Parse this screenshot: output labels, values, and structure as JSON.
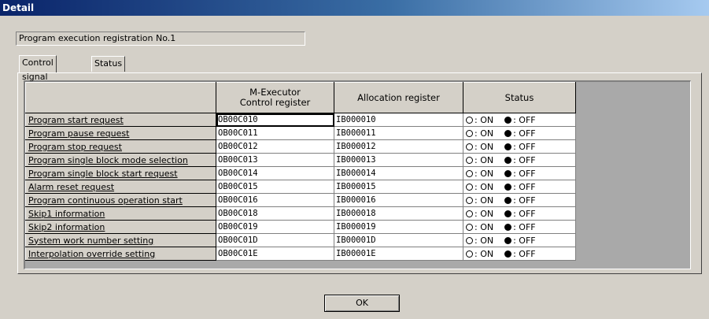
{
  "window": {
    "title": "Detail"
  },
  "group_label": "Program execution registration No.1",
  "tabs": [
    {
      "label": "Control signal"
    },
    {
      "label": "Status"
    }
  ],
  "table": {
    "headers": {
      "mexec_line1": "M-Executor",
      "mexec_line2": "Control register",
      "alloc": "Allocation register",
      "status": "Status"
    },
    "status_on": ": ON",
    "status_off": ": OFF",
    "rows": [
      {
        "name": "Program start request",
        "mexec": "OB00C010",
        "alloc": "IB000010"
      },
      {
        "name": "Program pause request",
        "mexec": "OB00C011",
        "alloc": "IB000011"
      },
      {
        "name": "Program stop request",
        "mexec": "OB00C012",
        "alloc": "IB000012"
      },
      {
        "name": "Program single block mode selection",
        "mexec": "OB00C013",
        "alloc": "IB000013"
      },
      {
        "name": "Program single block start request",
        "mexec": "OB00C014",
        "alloc": "IB000014"
      },
      {
        "name": "Alarm reset request",
        "mexec": "OB00C015",
        "alloc": "IB000015"
      },
      {
        "name": "Program continuous operation start",
        "mexec": "OB00C016",
        "alloc": "IB000016"
      },
      {
        "name": "Skip1 information",
        "mexec": "OB00C018",
        "alloc": "IB000018"
      },
      {
        "name": "Skip2 information",
        "mexec": "OB00C019",
        "alloc": "IB000019"
      },
      {
        "name": "System work number setting",
        "mexec": "OB00C01D",
        "alloc": "IB00001D"
      },
      {
        "name": "Interpolation override setting",
        "mexec": "OB00C01E",
        "alloc": "IB00001E"
      }
    ]
  },
  "ok_label": "OK"
}
